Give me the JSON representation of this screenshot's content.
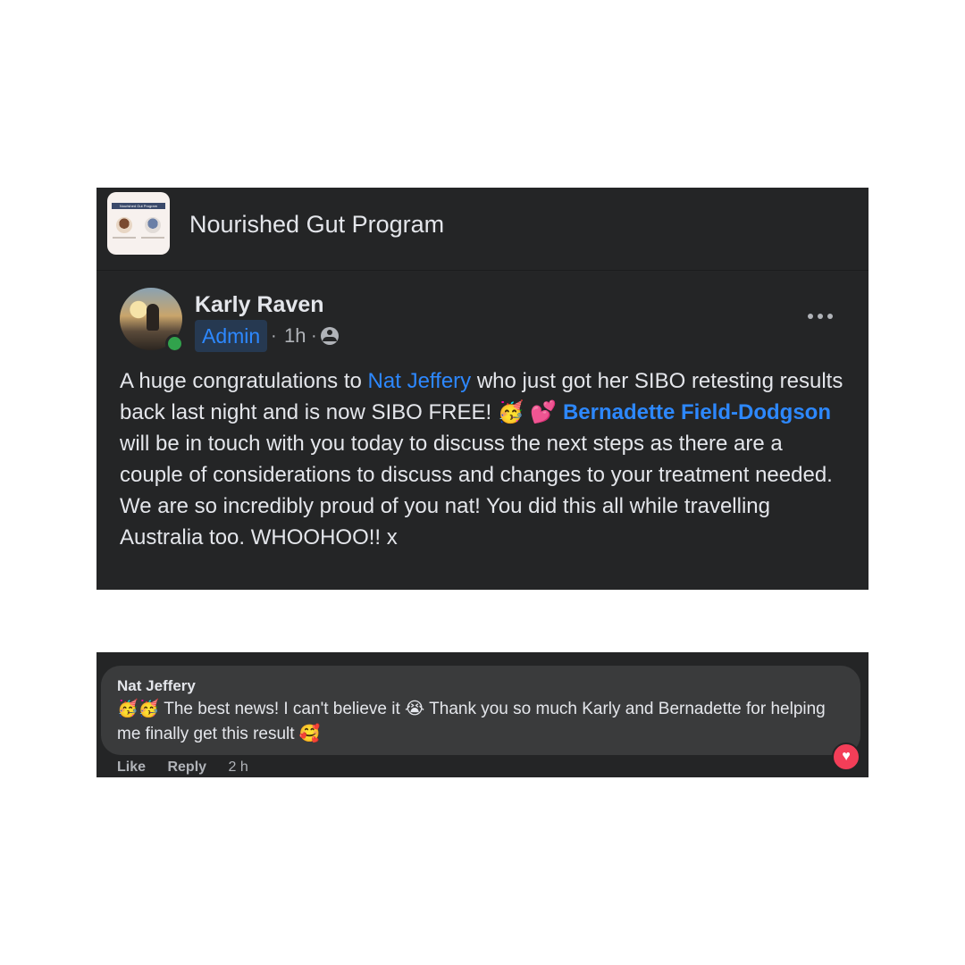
{
  "group": {
    "name": "Nourished Gut Program",
    "thumb_title": "Nourished Gut Program"
  },
  "post": {
    "author": "Karly Raven",
    "role_badge": "Admin",
    "time": "1h",
    "separator": "·",
    "audience_icon": "group-members-icon",
    "more_icon": "more-options-icon",
    "text": {
      "p1": "A huge congratulations to ",
      "mention1": "Nat Jeffery",
      "p2": " who just got her SIBO retesting results back last night and is now SIBO FREE! 🥳 💕",
      "mention2": "Bernadette Field-Dodgson",
      "p3": " will be in touch with you today to discuss the next steps as there are a couple of considerations to discuss and changes to your treatment needed. We are so incredibly proud of you nat! You did this all while travelling Australia too. WHOOHOO!! x"
    }
  },
  "comment": {
    "author": "Nat Jeffery",
    "text": "🥳🥳 The best news! I can't believe it 😭 Thank you so much Karly and Bernadette for helping me finally get this result 🥰",
    "reaction": "love",
    "reaction_glyph": "♥",
    "actions": {
      "like": "Like",
      "reply": "Reply",
      "time": "2 h"
    }
  },
  "colors": {
    "card_bg": "#242526",
    "bubble_bg": "#3a3b3c",
    "primary_text": "#e4e6eb",
    "secondary_text": "#b0b3b8",
    "link": "#2d88ff",
    "badge_bg": "#263951",
    "online": "#31a24c",
    "love": "#f33e58"
  }
}
